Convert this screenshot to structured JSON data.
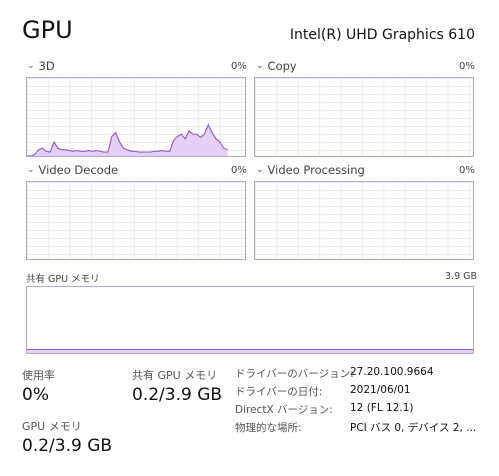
{
  "header": {
    "title": "GPU",
    "adapter": "Intel(R) UHD Graphics 610"
  },
  "engines": [
    {
      "label": "3D",
      "percent": "0%",
      "history": [
        0,
        0,
        2,
        8,
        10,
        6,
        5,
        18,
        10,
        8,
        8,
        7,
        6,
        7,
        6,
        6,
        7,
        6,
        7,
        6,
        5,
        5,
        25,
        30,
        18,
        10,
        8,
        6,
        6,
        5,
        5,
        5,
        5,
        6,
        6,
        7,
        6,
        6,
        20,
        25,
        28,
        22,
        32,
        28,
        28,
        24,
        28,
        40,
        30,
        22,
        18,
        10,
        8
      ]
    },
    {
      "label": "Copy",
      "percent": "0%"
    },
    {
      "label": "Video Decode",
      "percent": "0%"
    },
    {
      "label": "Video Processing",
      "percent": "0%"
    }
  ],
  "shared_memory": {
    "label": "共有 GPU メモリ",
    "max": "3.9 GB",
    "usage_fraction": 0.05
  },
  "stats": {
    "utilization_label": "使用率",
    "utilization_value": "0%",
    "shared_label": "共有 GPU メモリ",
    "shared_value": "0.2/3.9 GB",
    "gpu_mem_label": "GPU メモリ",
    "gpu_mem_value": "0.2/3.9 GB"
  },
  "info": {
    "driver_version_key": "ドライバーのバージョン:",
    "driver_version": "27.20.100.9664",
    "driver_date_key": "ドライバーの日付:",
    "driver_date": "2021/06/01",
    "directx_key": "DirectX バージョン:",
    "directx": "12 (FL 12.1)",
    "location_key": "物理的な場所:",
    "location": "PCI バス 0, デバイス 2, ..."
  },
  "colors": {
    "accent": "#9b59d0",
    "accent_fill": "#e3d0f4",
    "graph_border": "#b9a6cc"
  },
  "icons": {
    "chevron": "chevron-down-icon"
  }
}
